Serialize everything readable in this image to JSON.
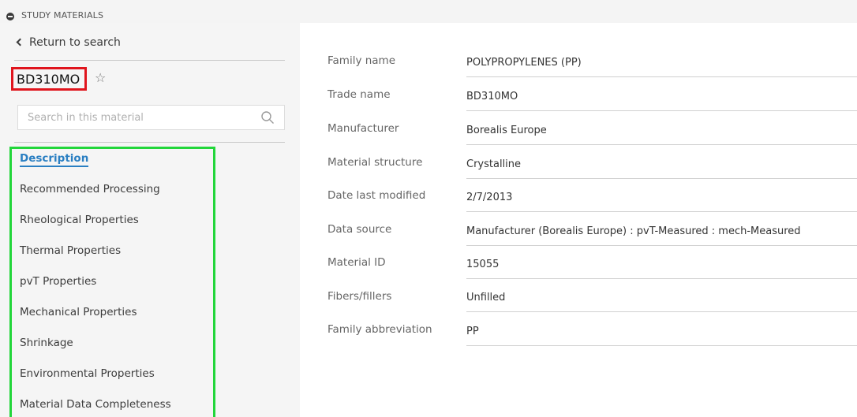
{
  "header": {
    "title": "STUDY MATERIALS"
  },
  "sidebar": {
    "return_label": "Return to search",
    "material_name": "BD310MO",
    "search_placeholder": "Search in this material",
    "nav": [
      {
        "label": "Description",
        "active": true
      },
      {
        "label": "Recommended Processing"
      },
      {
        "label": "Rheological Properties"
      },
      {
        "label": "Thermal Properties"
      },
      {
        "label": "pvT Properties"
      },
      {
        "label": "Mechanical Properties"
      },
      {
        "label": "Shrinkage"
      },
      {
        "label": "Environmental Properties"
      },
      {
        "label": "Material Data Completeness"
      }
    ]
  },
  "properties": [
    {
      "label": "Family name",
      "value": "POLYPROPYLENES (PP)"
    },
    {
      "label": "Trade name",
      "value": "BD310MO"
    },
    {
      "label": "Manufacturer",
      "value": "Borealis Europe"
    },
    {
      "label": "Material structure",
      "value": "Crystalline"
    },
    {
      "label": "Date last modified",
      "value": "2/7/2013"
    },
    {
      "label": "Data source",
      "value": "Manufacturer (Borealis Europe)  : pvT-Measured : mech-Measured"
    },
    {
      "label": "Material ID",
      "value": "15055"
    },
    {
      "label": "Fibers/fillers",
      "value": "Unfilled"
    },
    {
      "label": "Family abbreviation",
      "value": "PP"
    }
  ],
  "colors": {
    "active_link": "#2a7fc2",
    "highlight_red": "#e0151d",
    "highlight_green": "#22d63a"
  }
}
